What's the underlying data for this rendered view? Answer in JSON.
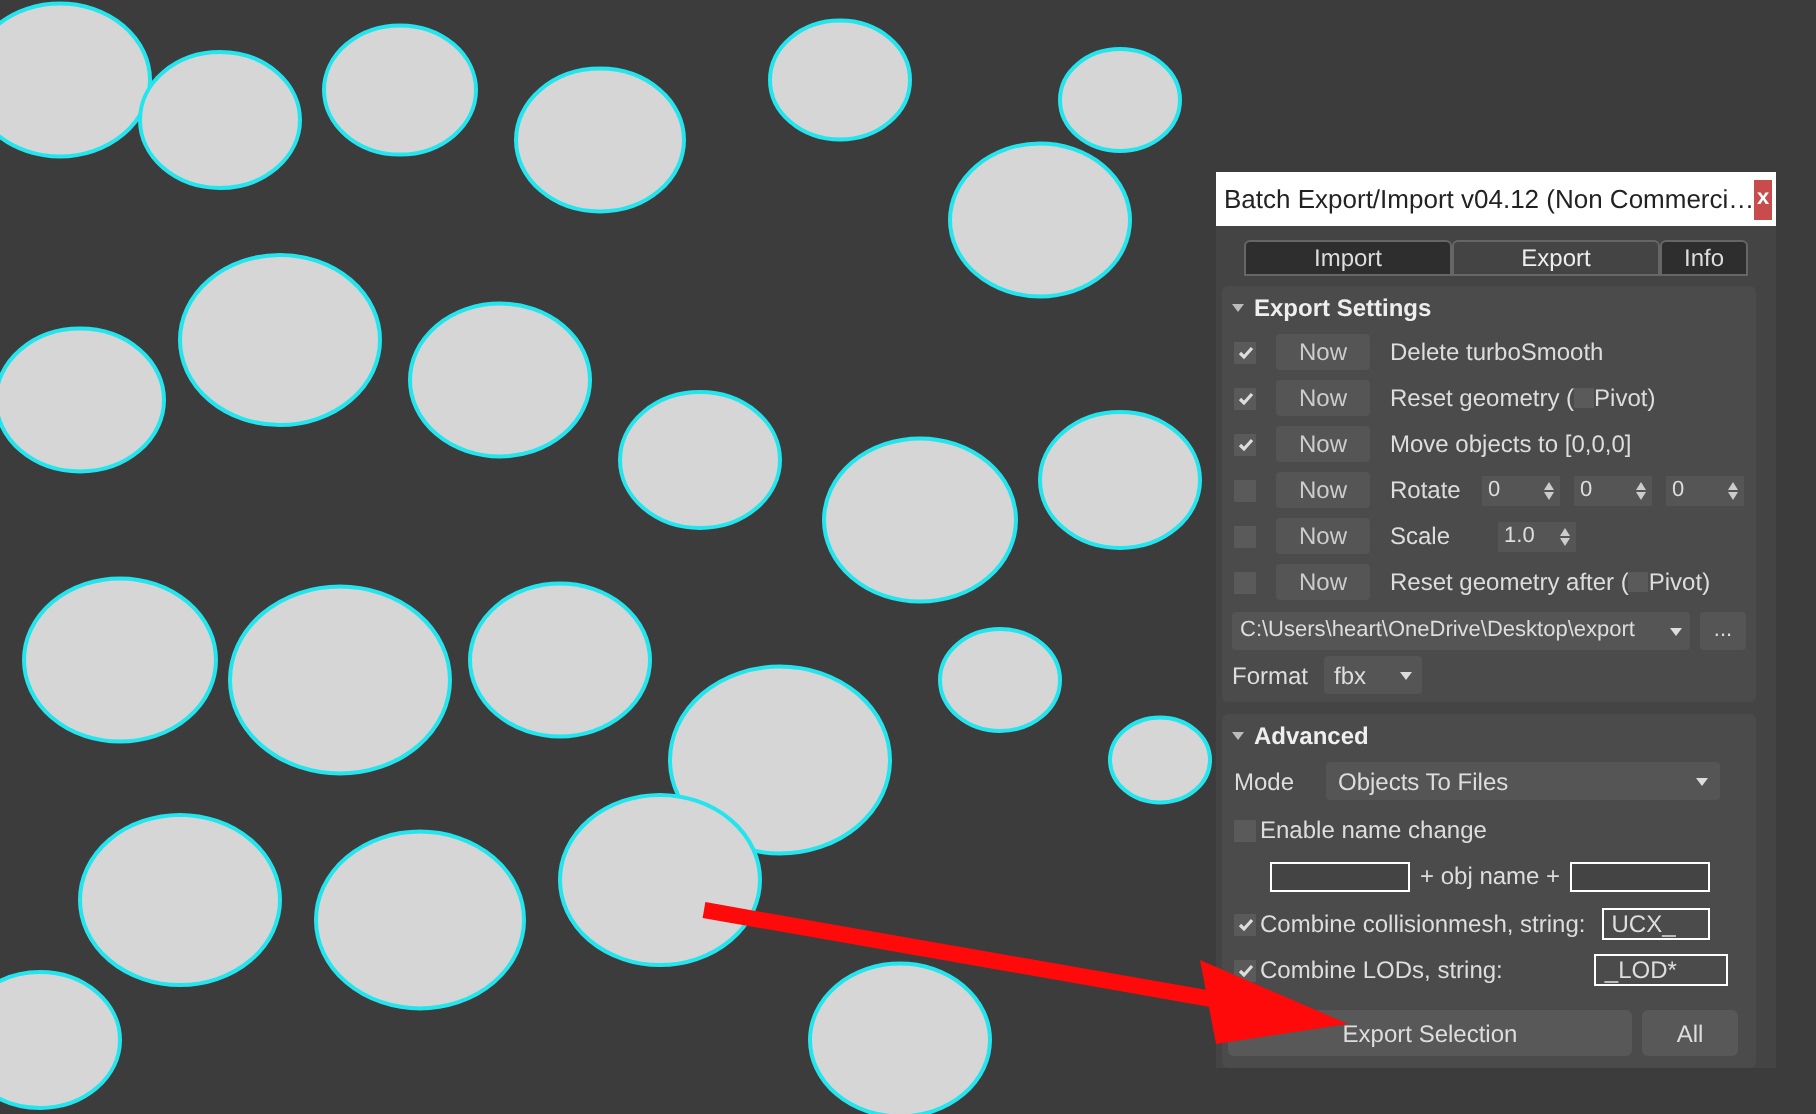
{
  "window": {
    "title": "Batch Export/Import v04.12 (Non Commerci…",
    "close": "x"
  },
  "tabs": [
    {
      "label": "Import",
      "selected": false
    },
    {
      "label": "Export",
      "selected": true
    },
    {
      "label": "Info",
      "selected": false
    }
  ],
  "export_settings": {
    "title": "Export Settings",
    "rows": [
      {
        "kind": "plain",
        "checked": true,
        "button": "Now",
        "label": "Delete turboSmooth"
      },
      {
        "kind": "pivot",
        "checked": true,
        "button": "Now",
        "label": "Reset geometry (",
        "pivot_checked": false,
        "pivot_label": "Pivot)"
      },
      {
        "kind": "plain",
        "checked": true,
        "button": "Now",
        "label": "Move objects to [0,0,0]"
      },
      {
        "kind": "spinners",
        "checked": false,
        "button": "Now",
        "label": "Rotate",
        "spinners": [
          "0",
          "0",
          "0"
        ]
      },
      {
        "kind": "spinners",
        "checked": false,
        "button": "Now",
        "label": "Scale",
        "spinners": [
          "1.0"
        ]
      },
      {
        "kind": "pivot",
        "checked": false,
        "button": "Now",
        "label": "Reset geometry after (",
        "pivot_checked": false,
        "pivot_label": "Pivot)"
      }
    ],
    "path": "C:\\Users\\heart\\OneDrive\\Desktop\\export",
    "browse": "...",
    "format_label": "Format",
    "format": "fbx"
  },
  "advanced": {
    "title": "Advanced",
    "mode_label": "Mode",
    "mode": "Objects To Files",
    "name_change": {
      "label": "Enable name change",
      "checked": false
    },
    "name_middle": "+ obj name +",
    "combine": [
      {
        "label": "Combine collisionmesh, string:",
        "checked": true,
        "value": "UCX_"
      },
      {
        "label": "Combine LODs, string:",
        "checked": true,
        "value": "_LOD*"
      }
    ],
    "export_button": "Export Selection",
    "all_button": "All"
  }
}
